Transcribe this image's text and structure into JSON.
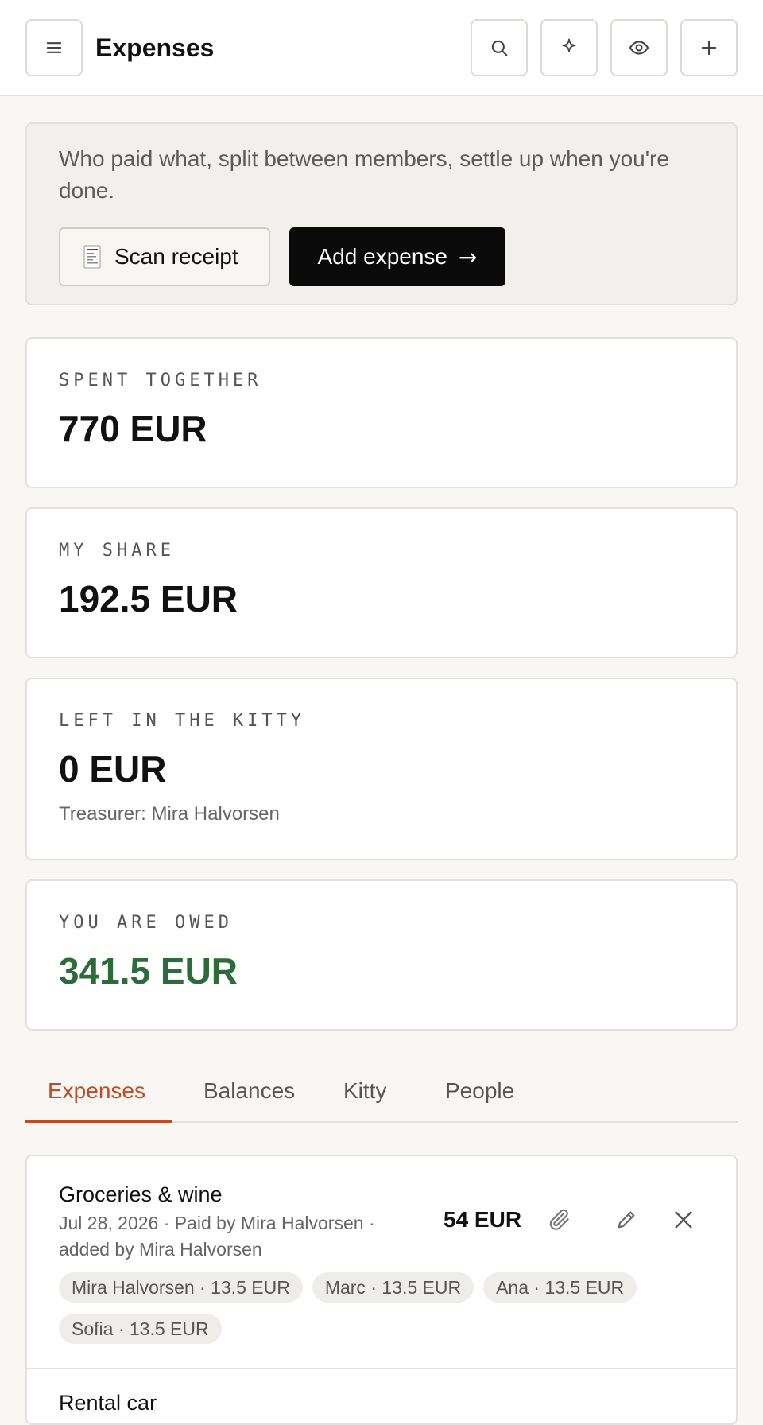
{
  "header": {
    "title": "Expenses",
    "icons": [
      "menu-icon",
      "search-icon",
      "sparkle-icon",
      "eye-icon",
      "plus-icon"
    ]
  },
  "intro": {
    "text": "Who paid what, split between members, settle up when you're done.",
    "scan_label": "Scan receipt",
    "add_label": "Add expense",
    "add_arrow": "→"
  },
  "stats": {
    "spent": {
      "label": "Spent together",
      "value": "770 EUR"
    },
    "share": {
      "label": "My share",
      "value": "192.5 EUR"
    },
    "kitty": {
      "label": "Left in the kitty",
      "value": "0 EUR",
      "sub": "Treasurer: Mira Halvorsen"
    },
    "owed": {
      "label": "You are owed",
      "value": "341.5 EUR"
    }
  },
  "colors": {
    "accent": "#c24a25",
    "positive": "#2e6b3a",
    "primary_button": "#0a0a0a"
  },
  "tabs": [
    {
      "label": "Expenses",
      "active": true
    },
    {
      "label": "Balances",
      "active": false
    },
    {
      "label": "Kitty",
      "active": false
    },
    {
      "label": "People",
      "active": false
    }
  ],
  "expenses": [
    {
      "title": "Groceries & wine",
      "meta": "Jul 28, 2026 · Paid by Mira Halvorsen · added by Mira Halvorsen",
      "amount": "54 EUR",
      "splits": [
        "Mira Halvorsen · 13.5 EUR",
        "Marc · 13.5 EUR",
        "Ana · 13.5 EUR",
        "Sofia · 13.5 EUR"
      ]
    },
    {
      "title": "Rental car"
    }
  ]
}
